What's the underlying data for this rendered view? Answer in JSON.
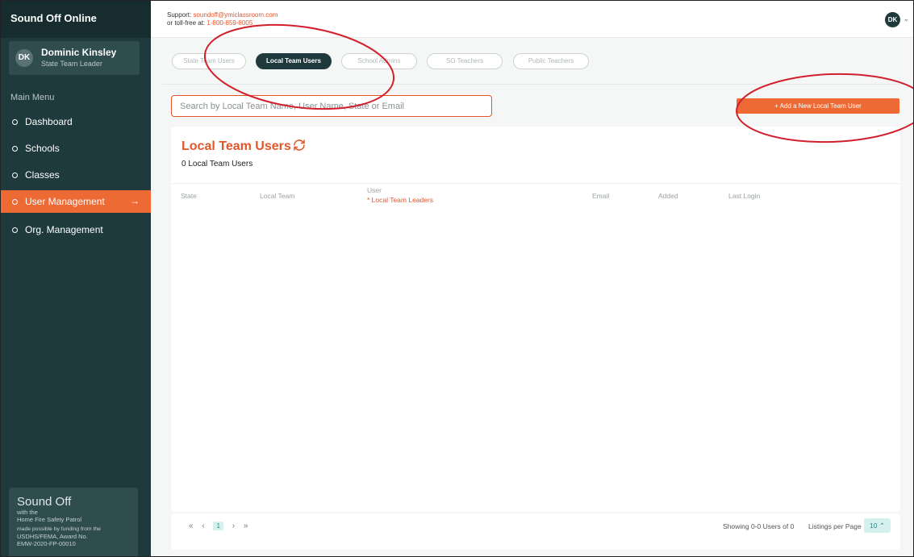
{
  "app": {
    "brand": "Sound Off Online"
  },
  "user": {
    "initials": "DK",
    "name": "Dominic Kinsley",
    "role": "State Team Leader"
  },
  "sidebar": {
    "menu_label": "Main Menu",
    "items": [
      {
        "label": "Dashboard"
      },
      {
        "label": "Schools"
      },
      {
        "label": "Classes"
      },
      {
        "label": "User Management",
        "active": true
      },
      {
        "label": "Org. Management"
      }
    ],
    "promo": {
      "title": "Sound Off",
      "line1": "with the",
      "line2": "Home Fire Safety Patrol",
      "line3": "made possible by funding from the",
      "line4": "USDHS/FEMA, Award No.",
      "line5": "EMW-2020-FP-00010"
    }
  },
  "header": {
    "support_label": "Support:",
    "support_email": "soundoff@ymiclassroom.com",
    "tollfree_label": "or toll-free at:",
    "tollfree_number": "1-800-859-8005"
  },
  "tabs": [
    {
      "label": "State Team Users"
    },
    {
      "label": "Local Team Users",
      "active": true
    },
    {
      "label": "School Admins"
    },
    {
      "label": "SO Teachers"
    },
    {
      "label": "Public Teachers"
    }
  ],
  "search": {
    "placeholder": "Search by Local Team Name, User Name, State or Email"
  },
  "add_button": {
    "label": "+ Add a New Local Team User"
  },
  "card": {
    "title": "Local Team Users",
    "count": "0 Local Team Users",
    "columns": {
      "state": "State",
      "local_team": "Local Team",
      "user": "User",
      "user_sub": "* Local Team Leaders",
      "email": "Email",
      "added": "Added",
      "last_login": "Last Login"
    }
  },
  "pagination": {
    "first": "«",
    "prev": "‹",
    "current": "1",
    "next": "›",
    "last": "»",
    "showing": "Showing 0-0 Users of 0",
    "per_page_label": "Listings per Page",
    "per_page_value": "10",
    "per_page_icon": "chevron-up-icon"
  },
  "colors": {
    "accent": "#ee6a34",
    "sidebar": "#1f3a3d",
    "annotation": "#d11f2c"
  }
}
